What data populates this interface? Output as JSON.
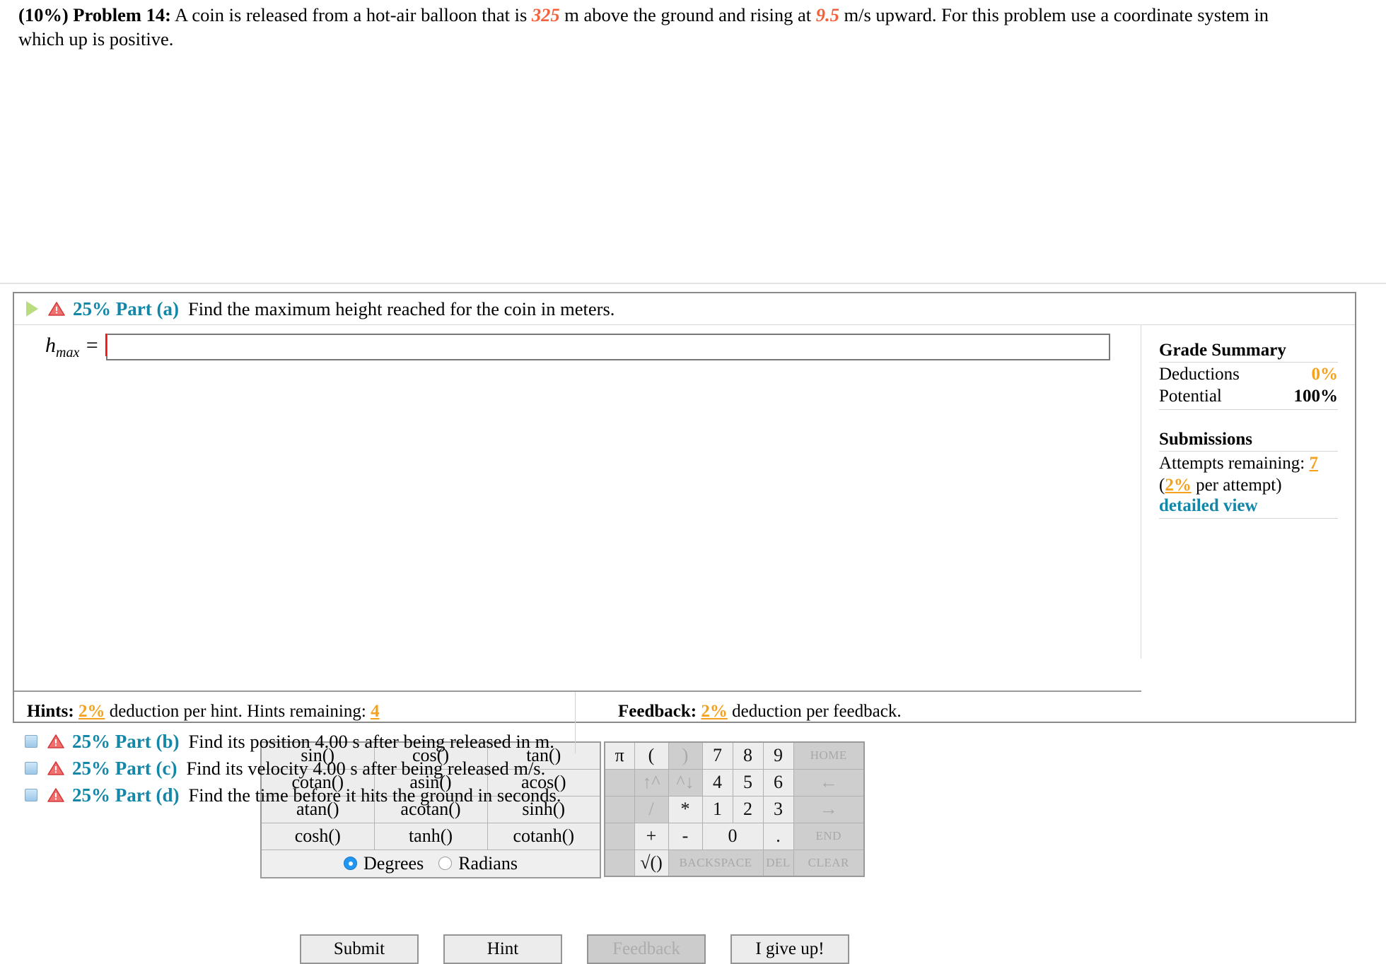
{
  "problem": {
    "percent": "(10%)",
    "label": "Problem 14:",
    "text_1": " A coin is released from a hot-air balloon that is ",
    "value_1": "325",
    "text_2": " m above the ground and rising at ",
    "value_2": "9.5",
    "text_3": " m/s upward. For this problem use a coordinate system in which up is positive."
  },
  "part_a": {
    "percent_label": "25% Part (a)",
    "prompt": "Find the maximum height reached for the coin in meters.",
    "answer_label": "h",
    "answer_sub": "max",
    "equals": "=",
    "answer_value": "",
    "answer_placeholder": ""
  },
  "calculator": {
    "functions": [
      [
        "sin()",
        "cos()",
        "tan()"
      ],
      [
        "cotan()",
        "asin()",
        "acos()"
      ],
      [
        "atan()",
        "acotan()",
        "sinh()"
      ],
      [
        "cosh()",
        "tanh()",
        "cotanh()"
      ]
    ],
    "angle_mode": {
      "degrees_label": "Degrees",
      "radians_label": "Radians",
      "selected": "Degrees"
    },
    "keypad": {
      "row1": [
        "π",
        "(",
        ")",
        "7",
        "8",
        "9",
        "HOME"
      ],
      "row2": [
        "",
        "↑^",
        "^↓",
        "4",
        "5",
        "6",
        "←"
      ],
      "row3": [
        "",
        "/",
        "*",
        "1",
        "2",
        "3",
        "→"
      ],
      "row4": [
        "",
        "+",
        "-",
        "0",
        ".",
        "END"
      ],
      "row5": [
        "",
        "√()",
        "BACKSPACE",
        "DEL",
        "CLEAR"
      ]
    }
  },
  "actions": {
    "submit": "Submit",
    "hint": "Hint",
    "feedback": "Feedback",
    "give_up": "I give up!"
  },
  "footer": {
    "hints_prefix": "Hints:",
    "hints_pct": "2%",
    "hints_mid": " deduction per hint. Hints remaining: ",
    "hints_remaining": "4",
    "feedback_prefix": "Feedback:",
    "feedback_pct": "2%",
    "feedback_suffix": " deduction per feedback."
  },
  "grade_summary": {
    "title": "Grade Summary",
    "deductions_label": "Deductions",
    "deductions_value": "0%",
    "potential_label": "Potential",
    "potential_value": "100%",
    "submissions_title": "Submissions",
    "attempts_label": "Attempts remaining:",
    "attempts_value": "7",
    "per_attempt_open": "(",
    "per_attempt_pct": "2%",
    "per_attempt_close": " per attempt)",
    "detailed_view": "detailed view"
  },
  "other_parts": [
    {
      "percent_label": "25% Part (b)",
      "prompt": "Find its position 4.00 s after being released in m."
    },
    {
      "percent_label": "25% Part (c)",
      "prompt": "Find its velocity 4.00 s after being released m/s."
    },
    {
      "percent_label": "25% Part (d)",
      "prompt": "Find the time before it hits the ground in seconds."
    }
  ],
  "colors": {
    "accent_teal": "#1287a8",
    "value_red": "#f4613c",
    "orange": "#f5a11b",
    "warning_red": "#e03b3b",
    "play_green": "#b9dd7e"
  }
}
